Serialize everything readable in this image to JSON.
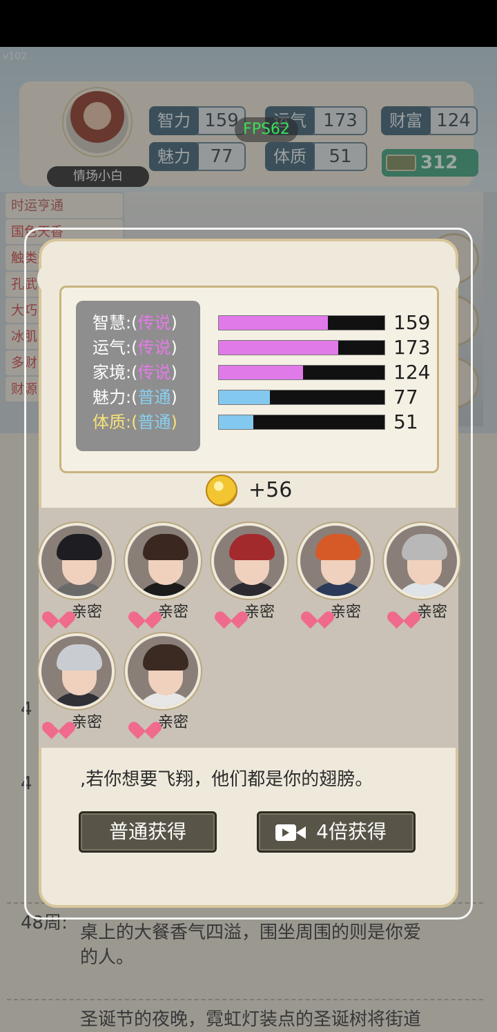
{
  "app": {
    "version": "v102",
    "fps": "FPS62"
  },
  "player": {
    "name": "情场小白",
    "stats": [
      {
        "key": "智力",
        "value": "159"
      },
      {
        "key": "运气",
        "value": "173"
      },
      {
        "key": "财富",
        "value": "124"
      },
      {
        "key": "魅力",
        "value": "77"
      },
      {
        "key": "体质",
        "value": "51"
      }
    ],
    "money": "312"
  },
  "side_list": [
    "时运亨通",
    "国色天香",
    "触类旁通",
    "孔武",
    "大巧",
    "冰肌",
    "多财",
    "财源"
  ],
  "background_text": {
    "week": "48周:",
    "lines": [
      "桌上的大餐香气四溢，围坐周围的则是你爱",
      "的人。",
      "圣诞节的夜晚，霓虹灯装点的圣诞树将街道"
    ],
    "number_a": "4",
    "number_b": "4"
  },
  "popup": {
    "stats": [
      {
        "name": "智慧",
        "rank": "传说",
        "rank_type": "legend",
        "value": 159,
        "fill": 0.66,
        "color": "#e07ae8"
      },
      {
        "name": "运气",
        "rank": "传说",
        "rank_type": "legend",
        "value": 173,
        "fill": 0.72,
        "color": "#e07ae8"
      },
      {
        "name": "家境",
        "rank": "传说",
        "rank_type": "legend",
        "value": 124,
        "fill": 0.51,
        "color": "#e07ae8"
      },
      {
        "name": "魅力",
        "rank": "普通",
        "rank_type": "common",
        "value": 77,
        "fill": 0.31,
        "color": "#83c8ee"
      },
      {
        "name": "体质",
        "rank": "普通",
        "rank_type": "common",
        "value": 51,
        "fill": 0.21,
        "color": "#83c8ee"
      }
    ],
    "reward": "+56",
    "characters": [
      {
        "tag": "亲密",
        "hair": "#1d1d22",
        "shirt": "#6a6a6a"
      },
      {
        "tag": "亲密",
        "hair": "#3a2820",
        "shirt": "#1b1b1b"
      },
      {
        "tag": "亲密",
        "hair": "#a32a2c",
        "shirt": "#2a2a30"
      },
      {
        "tag": "亲密",
        "hair": "#d65a28",
        "shirt": "#2b3a5a"
      },
      {
        "tag": "亲密",
        "hair": "#b8b8b8",
        "shirt": "#dfe4e8"
      },
      {
        "tag": "亲密",
        "hair": "#c9cdd2",
        "shirt": "#2e3036"
      },
      {
        "tag": "亲密",
        "hair": "#3a2a22",
        "shirt": "#e7e7e7"
      }
    ],
    "quote": ",若你想要飞翔，他们都是你的翅膀。",
    "buttons": {
      "normal": "普通获得",
      "quad": "4倍获得"
    }
  }
}
